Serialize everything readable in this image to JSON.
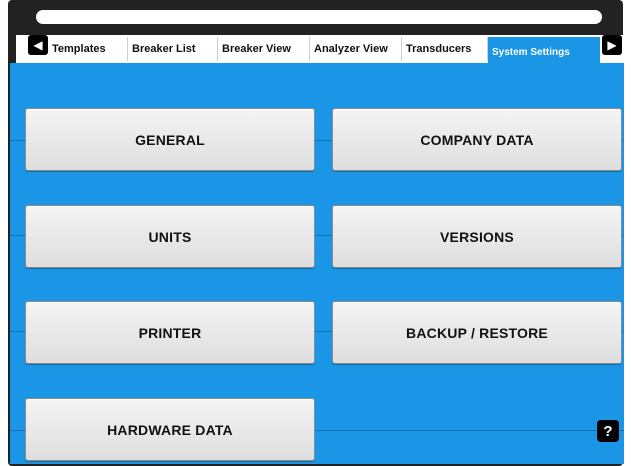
{
  "tabs": [
    {
      "label": "Templates",
      "active": false
    },
    {
      "label": "Breaker List",
      "active": false
    },
    {
      "label": "Breaker View",
      "active": false
    },
    {
      "label": "Analyzer View",
      "active": false
    },
    {
      "label": "Transducers",
      "active": false
    },
    {
      "label": "System Settings",
      "active": true
    }
  ],
  "buttons": {
    "general": "GENERAL",
    "company_data": "COMPANY DATA",
    "units": "UNITS",
    "versions": "VERSIONS",
    "printer": "PRINTER",
    "backup_restore": "BACKUP / RESTORE",
    "hardware_data": "HARDWARE DATA"
  },
  "help_label": "?",
  "colors": {
    "accent": "#1b96e6",
    "frame": "#222222",
    "button_face": "#e8e8e8"
  },
  "icons": {
    "scroll_left": "triangle-left-icon",
    "scroll_right": "triangle-right-icon"
  }
}
